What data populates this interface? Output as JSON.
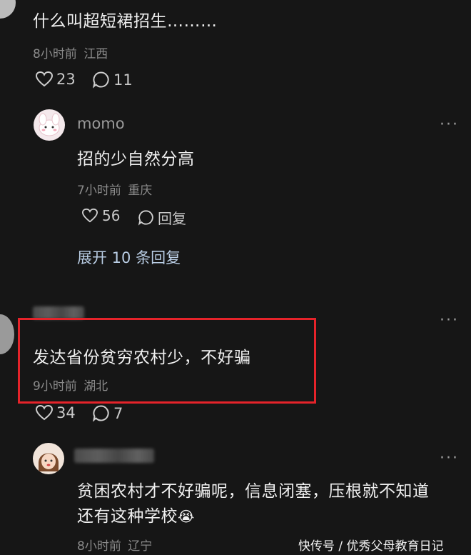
{
  "comments": {
    "c1": {
      "text": "什么叫超短裙招生………",
      "time": "8小时前",
      "location": "江西",
      "likes": "23",
      "replies": "11"
    },
    "c2": {
      "username": "momo",
      "text": "招的少自然分高",
      "time": "7小时前",
      "location": "重庆",
      "likes": "56",
      "reply_label": "回复",
      "expand_label": "展开 10 条回复"
    },
    "c3": {
      "text": "发达省份贫穷农村少，不好骗",
      "time": "9小时前",
      "location": "湖北",
      "likes": "34",
      "replies": "7"
    },
    "c4": {
      "text_line1": "贫困农村才不好骗呢，信息闭塞，压根就不知道",
      "text_line2": "还有这种学校",
      "emoji": "😭",
      "time": "8小时前",
      "location": "辽宁"
    }
  },
  "more_glyph": "···",
  "watermark": "快传号 / 优秀父母教育日记",
  "colors": {
    "background": "#161616",
    "highlight_border": "#e5232a",
    "text": "#efefef",
    "meta": "#8a8a8a"
  },
  "icons": [
    "heart-icon",
    "comment-bubble-icon",
    "more-dots-icon"
  ]
}
